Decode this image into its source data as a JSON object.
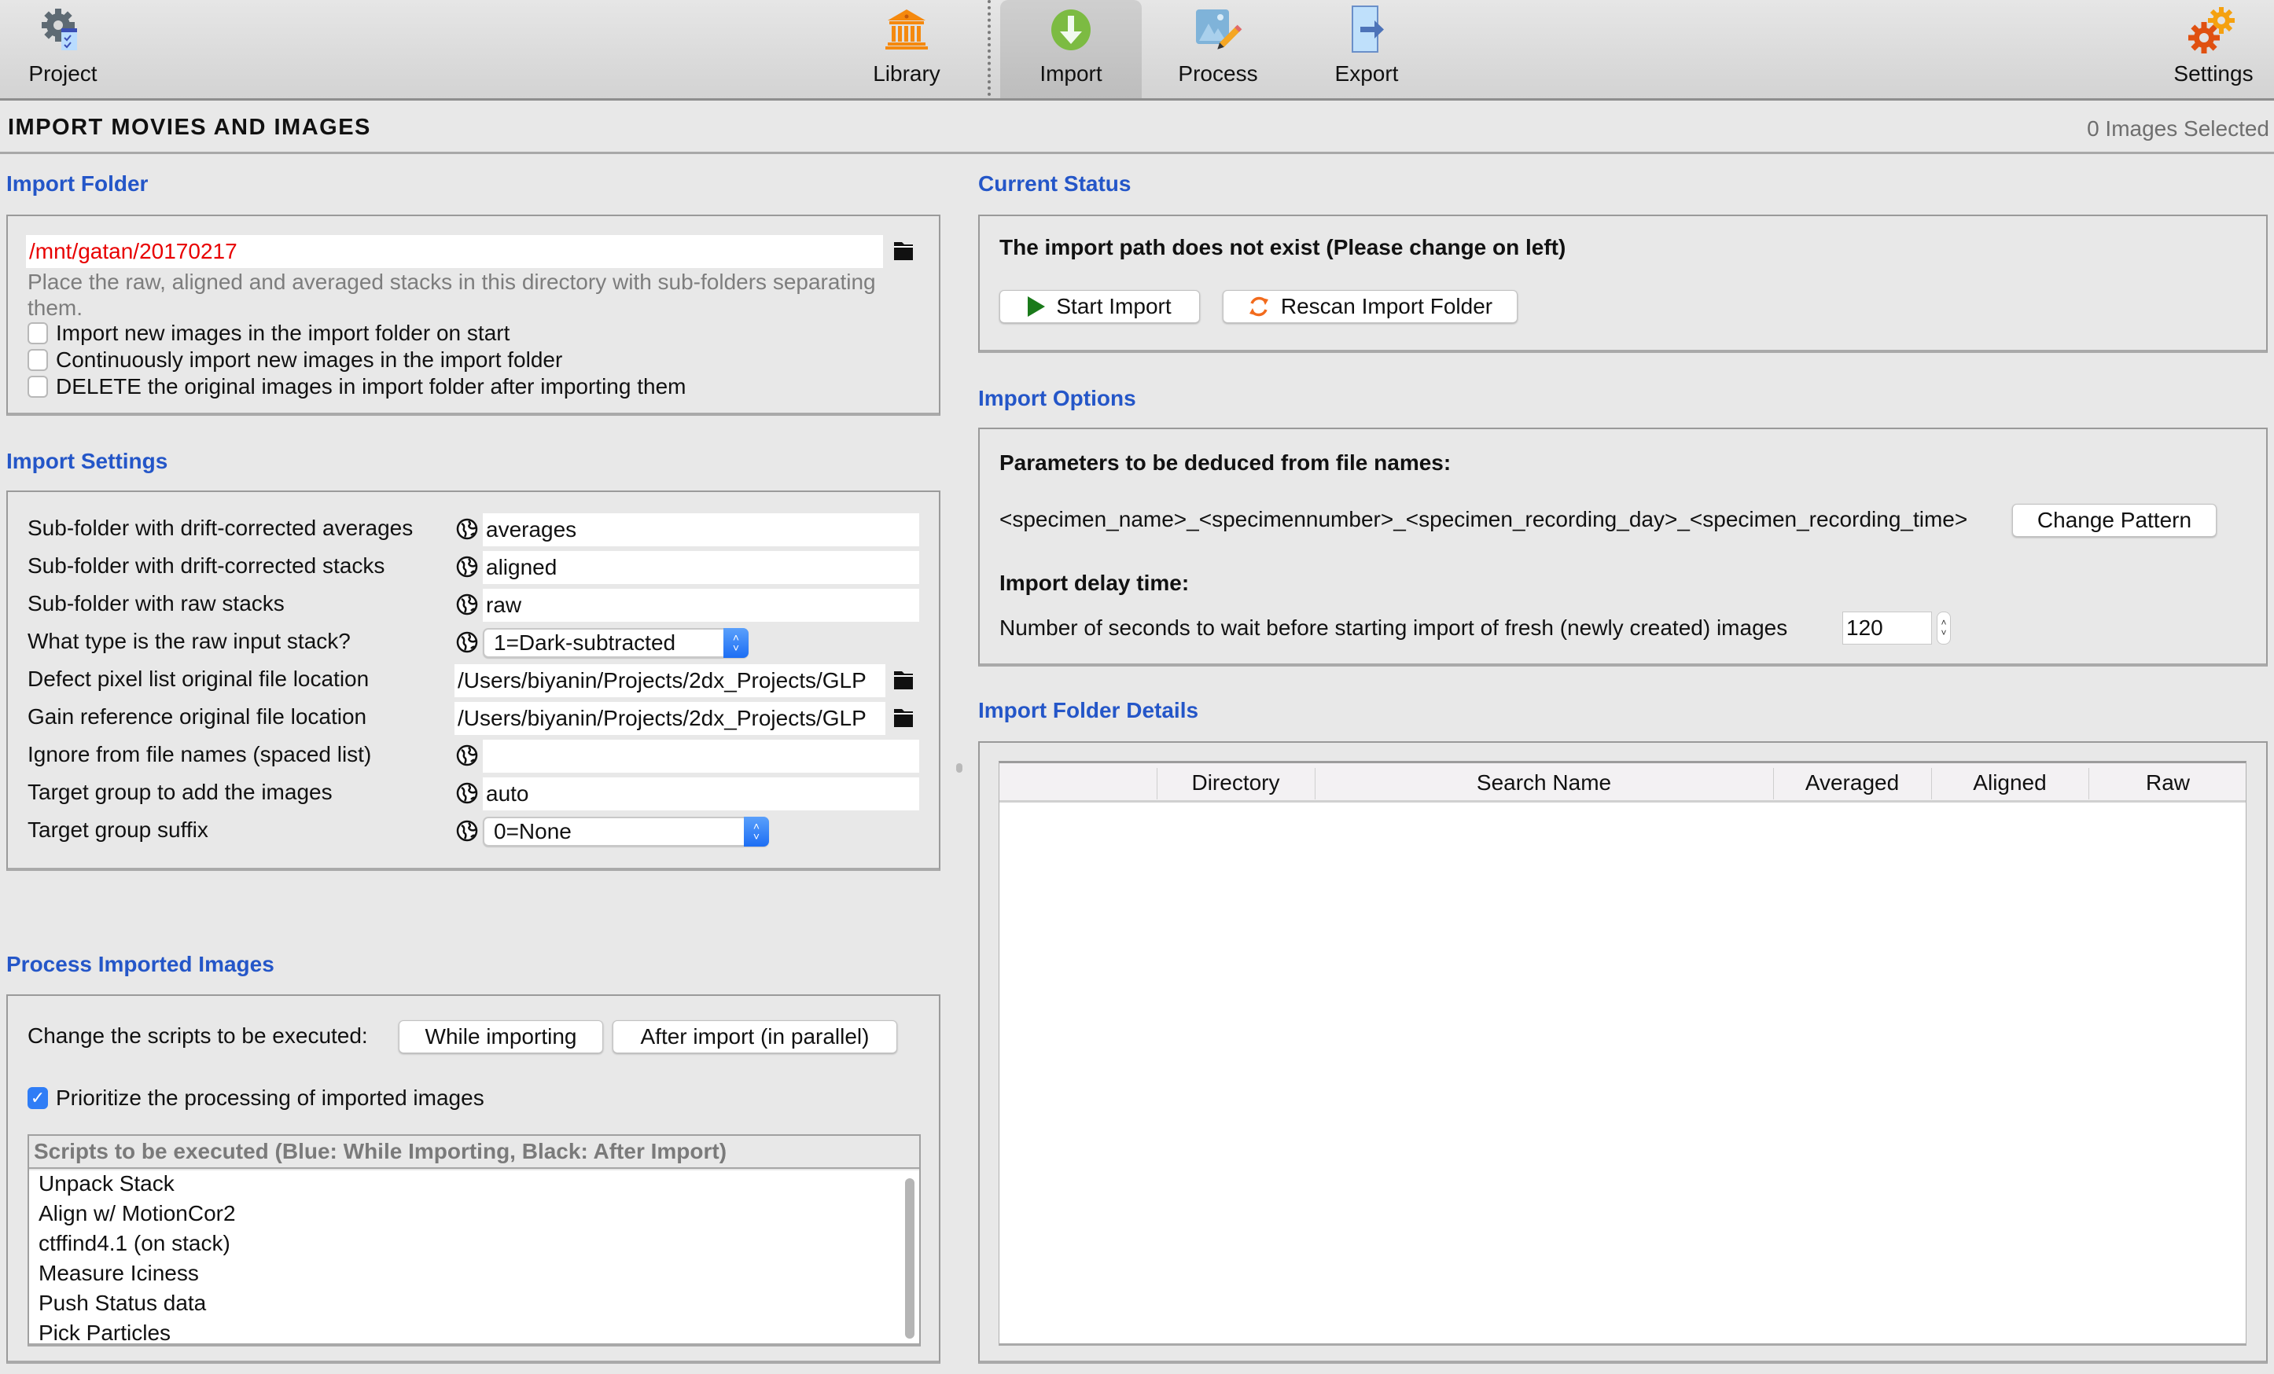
{
  "toolbar": {
    "items": [
      {
        "label": "Project",
        "icon": "project-gear-checklist-icon"
      },
      {
        "label": "Library",
        "icon": "library-building-icon"
      },
      {
        "label": "Import",
        "icon": "import-download-icon",
        "active": true
      },
      {
        "label": "Process",
        "icon": "process-image-edit-icon"
      },
      {
        "label": "Export",
        "icon": "export-arrow-icon"
      },
      {
        "label": "Settings",
        "icon": "settings-gears-icon"
      }
    ]
  },
  "header": {
    "title": "IMPORT MOVIES AND IMAGES",
    "selection_count": "0 Images Selected"
  },
  "import_folder": {
    "heading": "Import Folder",
    "path": "/mnt/gatan/20170217",
    "help": "Place the raw, aligned and averaged stacks in this directory with sub-folders separating them.",
    "checkboxes": [
      {
        "label": "Import new images in the import folder on start",
        "checked": false
      },
      {
        "label": "Continuously import new images in the import folder",
        "checked": false
      },
      {
        "label": "DELETE the original images in import folder after importing them",
        "checked": false
      }
    ]
  },
  "import_settings": {
    "heading": "Import Settings",
    "rows": [
      {
        "label": "Sub-folder with drift-corrected averages",
        "type": "text",
        "value": "averages"
      },
      {
        "label": "Sub-folder with drift-corrected stacks",
        "type": "text",
        "value": "aligned"
      },
      {
        "label": "Sub-folder with raw stacks",
        "type": "text",
        "value": "raw"
      },
      {
        "label": "What type is the raw input stack?",
        "type": "select",
        "value": "1=Dark-subtracted"
      },
      {
        "label": "Defect pixel list original file location",
        "type": "path",
        "value": "/Users/biyanin/Projects/2dx_Projects/GLP"
      },
      {
        "label": "Gain reference original file location",
        "type": "path",
        "value": "/Users/biyanin/Projects/2dx_Projects/GLP"
      },
      {
        "label": "Ignore from file names (spaced list)",
        "type": "text",
        "value": ""
      },
      {
        "label": "Target group to add the images",
        "type": "text",
        "value": "auto"
      },
      {
        "label": "Target group suffix",
        "type": "select",
        "value": "0=None"
      }
    ]
  },
  "process_imported": {
    "heading": "Process Imported Images",
    "change_label": "Change the scripts to be executed:",
    "while_importing_button": "While importing",
    "after_import_button": "After import (in parallel)",
    "prioritize_label": "Prioritize the processing of imported images",
    "prioritize_checked": true,
    "scripts_header": "Scripts to be executed (Blue: While Importing, Black: After Import)",
    "scripts": [
      "Unpack Stack",
      "Align w/ MotionCor2",
      "ctffind4.1 (on stack)",
      "Measure Iciness",
      "Push Status data",
      "Pick Particles"
    ]
  },
  "current_status": {
    "heading": "Current Status",
    "message": "The import path does not exist (Please change on left)",
    "start_button": "Start Import",
    "rescan_button": "Rescan Import Folder"
  },
  "import_options": {
    "heading": "Import Options",
    "params_label": "Parameters to be deduced from file names:",
    "pattern": "<specimen_name>_<specimennumber>_<specimen_recording_day>_<specimen_recording_time>",
    "change_pattern_button": "Change Pattern",
    "delay_label": "Import delay time:",
    "delay_description": "Number of seconds to wait before starting import of fresh (newly created) images",
    "delay_value": "120"
  },
  "folder_details": {
    "heading": "Import Folder Details",
    "columns": [
      "",
      "Directory",
      "Search Name",
      "Averaged",
      "Aligned",
      "Raw"
    ],
    "rows": []
  },
  "colors": {
    "heading_blue": "#2456c8",
    "path_error_red": "#e80000",
    "checkbox_blue": "#2f7df6",
    "start_green": "#1a7a1a",
    "rescan_orange": "#f26b1d"
  }
}
